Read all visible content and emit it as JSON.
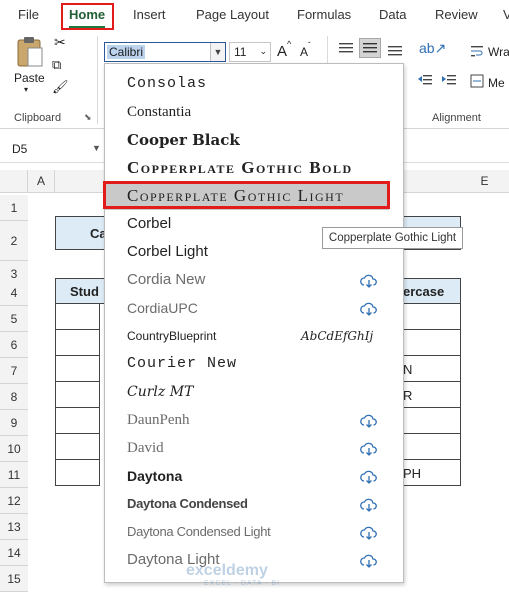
{
  "menu": {
    "tabs": [
      "File",
      "Home",
      "Insert",
      "Page Layout",
      "Formulas",
      "Data",
      "Review",
      "V"
    ]
  },
  "ribbon": {
    "paste_label": "Paste",
    "font_name": "Calibri",
    "font_size": "11",
    "grow_font_label": "A",
    "shrink_font_label": "A",
    "wrap_label": "Wra",
    "merge_label": "Me",
    "clipboard_label": "Clipboard",
    "alignment_label": "Alignment"
  },
  "name_box": {
    "value": "D5"
  },
  "columns": [
    "A",
    "E"
  ],
  "rows": [
    "1",
    "2",
    "3",
    "4",
    "5",
    "6",
    "7",
    "8",
    "9",
    "10",
    "11",
    "12",
    "13",
    "14",
    "15"
  ],
  "sheet_fragments": {
    "cell_b2": "Ca",
    "cell_b4": "Stud",
    "cell_e4": "ercase",
    "cell_e7": "N",
    "cell_e8": "R",
    "cell_e11": "PH"
  },
  "font_dropdown": {
    "items": [
      {
        "label": "Consolas",
        "cloud": false
      },
      {
        "label": "Constantia",
        "cloud": false
      },
      {
        "label": "Cooper Black",
        "cloud": false
      },
      {
        "label": "Copperplate Gothic Bold",
        "cloud": false
      },
      {
        "label": "Copperplate Gothic Light",
        "cloud": false
      },
      {
        "label": "Corbel",
        "cloud": false
      },
      {
        "label": "Corbel Light",
        "cloud": false
      },
      {
        "label": "Cordia New",
        "cloud": true
      },
      {
        "label": "CordiaUPC",
        "cloud": true
      },
      {
        "label": "CountryBlueprint",
        "cloud": false,
        "preview": "AbCdEfGhIj"
      },
      {
        "label": "Courier New",
        "cloud": false
      },
      {
        "label": "Curlz MT",
        "cloud": false
      },
      {
        "label": "DaunPenh",
        "cloud": true
      },
      {
        "label": "David",
        "cloud": true
      },
      {
        "label": "Daytona",
        "cloud": true
      },
      {
        "label": "Daytona Condensed",
        "cloud": true
      },
      {
        "label": "Daytona Condensed Light",
        "cloud": true
      },
      {
        "label": "Daytona Light",
        "cloud": true
      }
    ],
    "highlighted_index": 4
  },
  "tooltip": "Copperplate Gothic Light",
  "watermark": {
    "brand": "exceldemy",
    "tagline": "EXCEL · DATA · BI"
  },
  "colors": {
    "accent_green": "#1f7a3e",
    "highlight_red": "#e21b1b",
    "selection_blue": "#bcd3ee",
    "cloud_blue": "#2f6fb3"
  }
}
